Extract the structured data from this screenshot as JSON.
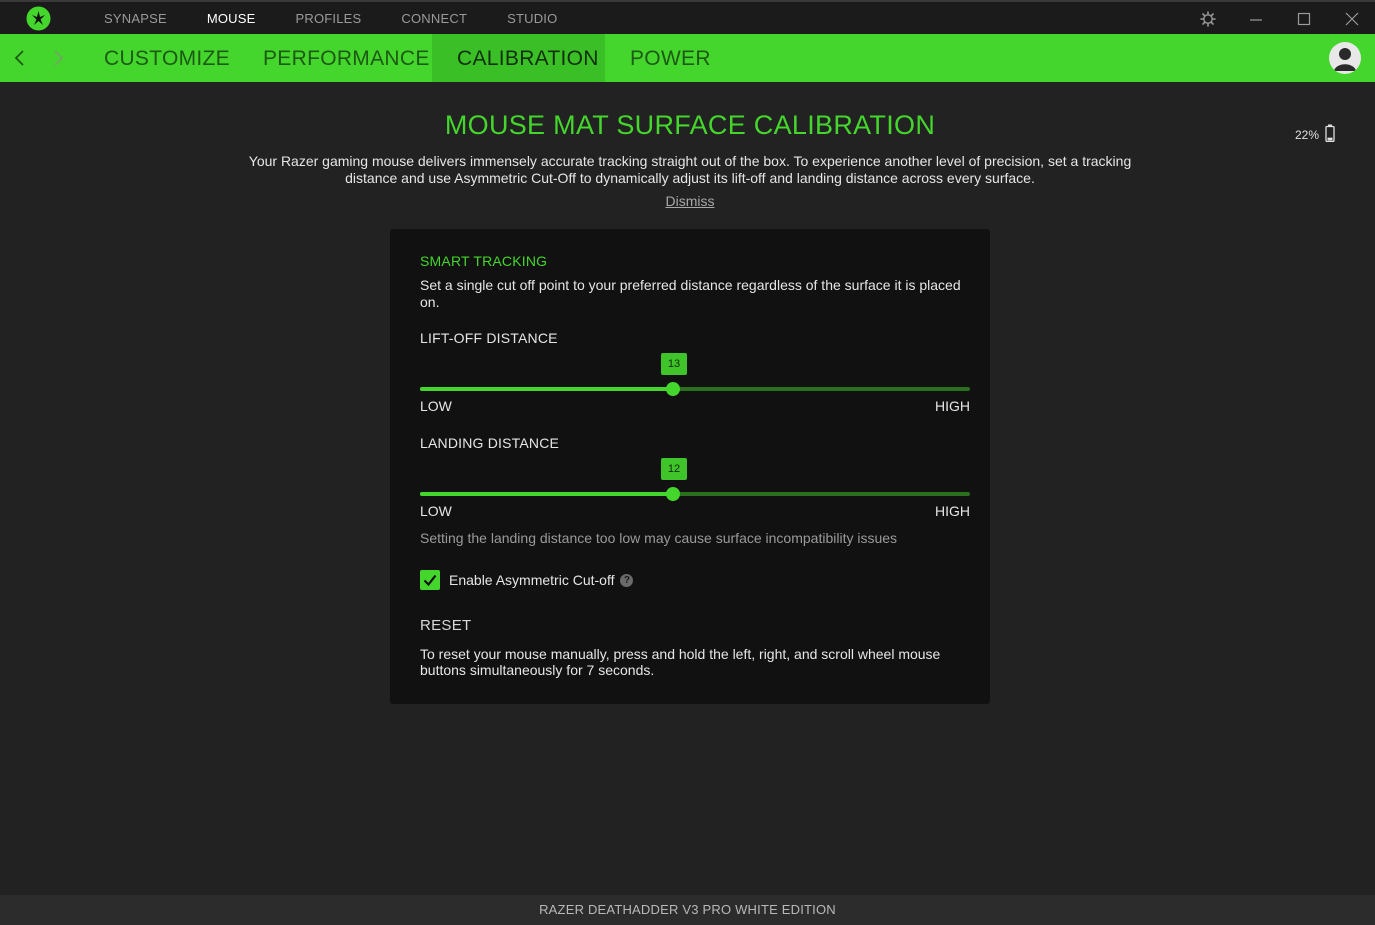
{
  "topnav": {
    "items": [
      {
        "label": "SYNAPSE",
        "active": false
      },
      {
        "label": "MOUSE",
        "active": true
      },
      {
        "label": "PROFILES",
        "active": false
      },
      {
        "label": "CONNECT",
        "active": false
      },
      {
        "label": "STUDIO",
        "active": false
      }
    ]
  },
  "subnav": {
    "tabs": [
      {
        "label": "CUSTOMIZE",
        "active": false
      },
      {
        "label": "PERFORMANCE",
        "active": false
      },
      {
        "label": "CALIBRATION",
        "active": true
      },
      {
        "label": "POWER",
        "active": false
      }
    ]
  },
  "colors": {
    "accent": "#44d62c",
    "background": "#222222",
    "panel": "#111111"
  },
  "icons": {
    "logo": "razer-logo-icon",
    "settings": "gear-icon",
    "minimize": "minimize-icon",
    "maximize": "maximize-icon",
    "close": "close-icon",
    "back": "chevron-left-icon",
    "forward": "chevron-right-icon",
    "profile": "user-avatar-icon",
    "battery": "battery-icon",
    "help": "help-icon",
    "check": "checkmark-icon"
  },
  "battery": {
    "percent_label": "22%",
    "level": 0.22
  },
  "main": {
    "title": "MOUSE MAT SURFACE CALIBRATION",
    "intro": "Your Razer gaming mouse delivers immensely accurate tracking straight out of the box. To experience another level of precision, set a tracking distance and use Asymmetric Cut-Off to dynamically adjust its lift-off and landing distance across every surface.",
    "dismiss": "Dismiss"
  },
  "panel": {
    "section_title": "SMART TRACKING",
    "section_desc": "Set a single cut off point to your preferred distance regardless of the surface it is placed on.",
    "liftoff": {
      "label": "LIFT-OFF DISTANCE",
      "value": "13",
      "fraction": 0.46,
      "low": "LOW",
      "high": "HIGH"
    },
    "landing": {
      "label": "LANDING DISTANCE",
      "value": "12",
      "fraction": 0.46,
      "low": "LOW",
      "high": "HIGH"
    },
    "warning": "Setting the landing distance too low may cause surface incompatibility issues",
    "asymmetric": {
      "label": "Enable Asymmetric Cut-off",
      "checked": true,
      "help": "?"
    },
    "reset_title": "RESET",
    "reset_desc": "To reset your mouse manually, press and hold the left, right, and scroll wheel mouse buttons simultaneously for 7 seconds."
  },
  "footer": {
    "device_name": "RAZER DEATHADDER V3 PRO WHITE EDITION"
  }
}
